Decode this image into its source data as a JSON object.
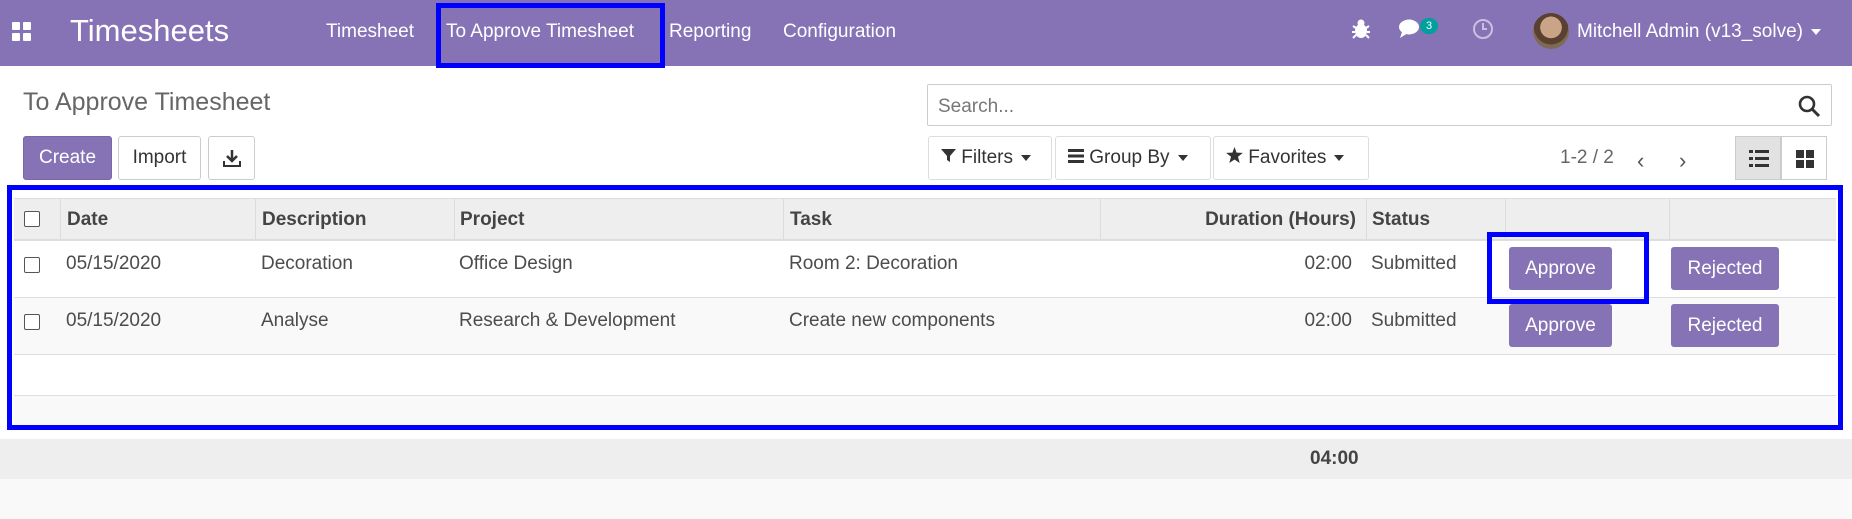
{
  "navbar": {
    "brand": "Timesheets",
    "menu": [
      "Timesheet",
      "To Approve Timesheet",
      "Reporting",
      "Configuration"
    ],
    "messages_badge": "3",
    "user": "Mitchell Admin (v13_solve)"
  },
  "page": {
    "title": "To Approve Timesheet",
    "create_label": "Create",
    "import_label": "Import"
  },
  "search": {
    "placeholder": "Search..."
  },
  "filters": {
    "filters_label": "Filters",
    "group_by_label": "Group By",
    "favorites_label": "Favorites"
  },
  "pager": {
    "text": "1-2 / 2"
  },
  "table": {
    "headers": [
      "Date",
      "Description",
      "Project",
      "Task",
      "Duration (Hours)",
      "Status"
    ],
    "rows": [
      {
        "date": "05/15/2020",
        "description": "Decoration",
        "project": "Office Design",
        "task": "Room 2: Decoration",
        "duration": "02:00",
        "status": "Submitted",
        "approve": "Approve",
        "reject": "Rejected"
      },
      {
        "date": "05/15/2020",
        "description": "Analyse",
        "project": "Research & Development",
        "task": "Create new components",
        "duration": "02:00",
        "status": "Submitted",
        "approve": "Approve",
        "reject": "Rejected"
      }
    ],
    "total": "04:00"
  },
  "colors": {
    "brand": "#8673b6",
    "highlight": "#0000ff",
    "badge": "#00a09d"
  }
}
